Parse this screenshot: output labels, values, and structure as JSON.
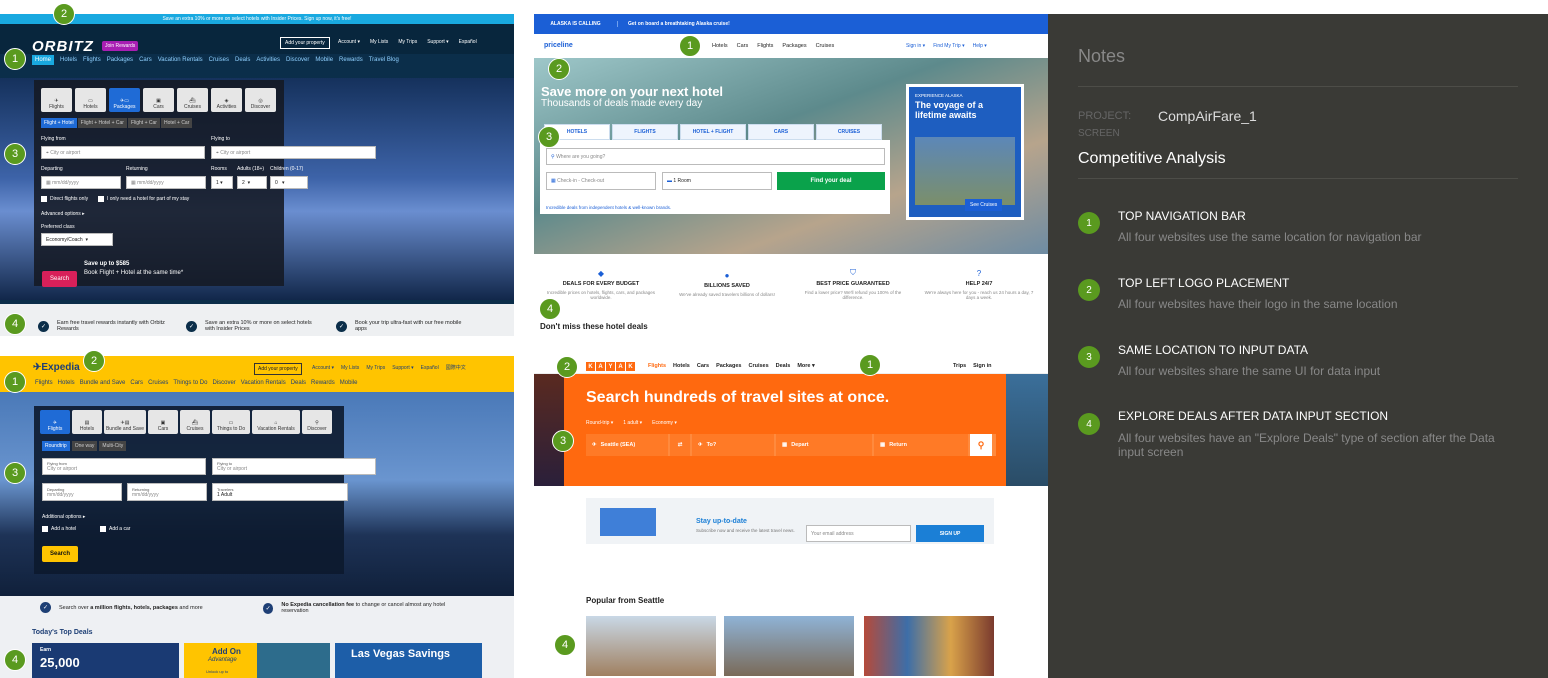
{
  "orbitz": {
    "promo": "Save an extra 10% or more on select hotels with Insider Prices.  Sign up now, it's free!",
    "logo": "ORBITZ",
    "join": "Join Rewards",
    "add_property": "Add your property",
    "account_links": [
      "Account ▾",
      "My Lists",
      "My Trips",
      "Support ▾",
      "Español"
    ],
    "nav": [
      "Home",
      "Hotels",
      "Flights",
      "Packages",
      "Cars",
      "Vacation Rentals",
      "Cruises",
      "Deals",
      "Activities",
      "Discover",
      "Mobile",
      "Rewards",
      "Travel Blog"
    ],
    "tabs": [
      "Flights",
      "Hotels",
      "Packages",
      "Cars",
      "Cruises",
      "Activities",
      "Discover"
    ],
    "subtabs": [
      "Flight + Hotel",
      "Flight + Hotel + Car",
      "Flight + Car",
      "Hotel + Car"
    ],
    "flying_from": "Flying from",
    "flying_to": "Flying to",
    "city_placeholder": "City or airport",
    "departing": "Departing",
    "returning": "Returning",
    "date_placeholder": "mm/dd/yyyy",
    "rooms": "Rooms",
    "adults": "Adults (18+)",
    "children": "Children (0-17)",
    "rooms_val": "1",
    "adults_val": "2",
    "children_val": "0",
    "direct": "Direct flights only",
    "partial": "I only need a hotel for part of my stay",
    "advanced": "Advanced options ▸",
    "pref_class": "Preferred class",
    "class_val": "Economy/Coach",
    "search": "Search",
    "save_title": "Save up to $585",
    "save_sub": "Book Flight + Hotel at the same time*",
    "benefits": [
      "Earn free travel rewards instantly with Orbitz Rewards",
      "Save an extra 10% or more on select hotels with Insider Prices",
      "Book your trip ultra-fast with our free mobile apps"
    ]
  },
  "priceline": {
    "alaska": "ALASKA IS CALLING",
    "alaska_sub": "Get on board a breathtaking Alaska cruise!",
    "logo": "priceline",
    "nav": [
      "Hotels",
      "Cars",
      "Flights",
      "Packages",
      "Cruises"
    ],
    "right": [
      "Sign in ▾",
      "Find My Trip ▾",
      "Help ▾"
    ],
    "h1": "Save more on your next hotel",
    "h2": "Thousands of deals made every day",
    "tabs": [
      "HOTELS",
      "FLIGHTS",
      "HOTEL + FLIGHT",
      "CARS",
      "CRUISES"
    ],
    "where": "Where are you going?",
    "checkin": "Check-in - Check-out",
    "rooms": "1 Room",
    "find": "Find your deal",
    "incredible": "Incredible deals from independent hotels & well-known brands.",
    "promo_kicker": "EXPERIENCE ALASKA",
    "promo_title": "The voyage of a lifetime awaits",
    "promo_cta": "See Cruises",
    "benefits": [
      {
        "title": "DEALS FOR EVERY BUDGET",
        "text": "Incredible prices on hotels, flights, cars, and packages worldwide."
      },
      {
        "title": "BILLIONS SAVED",
        "text": "We've already saved travelers billions of dollars!"
      },
      {
        "title": "BEST PRICE GUARANTEED",
        "text": "Find a lower price? We'll refund you 100% of the difference."
      },
      {
        "title": "HELP 24/7",
        "text": "We're always here for you - reach us 24 hours a day, 7 days a week."
      }
    ],
    "dont_miss": "Don't miss these hotel deals"
  },
  "expedia": {
    "logo": "Expedia",
    "add_property": "Add your property",
    "account_links": [
      "Account ▾",
      "My Lists",
      "My Trips",
      "Support ▾",
      "Español",
      "國際中文"
    ],
    "nav": [
      "Flights",
      "Hotels",
      "Bundle and Save",
      "Cars",
      "Cruises",
      "Things to Do",
      "Discover",
      "Vacation Rentals",
      "Deals",
      "Rewards",
      "Mobile"
    ],
    "tabs": [
      "Flights",
      "Hotels",
      "Bundle and Save",
      "Cars",
      "Cruises",
      "Things to Do",
      "Vacation Rentals",
      "Discover"
    ],
    "subtabs": [
      "Roundtrip",
      "One way",
      "Multi-City"
    ],
    "flying_from": "Flying from",
    "flying_to": "Flying to",
    "city_placeholder": "City or airport",
    "departing": "Departing",
    "returning": "Returning",
    "date_placeholder": "mm/dd/yyyy",
    "travelers": "Travelers",
    "travelers_val": "1 Adult",
    "additional": "Additional options ▸",
    "add_hotel": "Add a hotel",
    "add_car": "Add a car",
    "search": "Search",
    "benefit1_a": "Search over ",
    "benefit1_b": "a million flights, hotels, packages",
    "benefit1_c": " and more",
    "benefit2_a": "No Expedia cancellation fee",
    "benefit2_b": " to change or cancel almost any hotel reservation",
    "top_deals": "Today's Top Deals",
    "deal1_small": "Earn",
    "deal1_big": "25,000",
    "deal2_a": "Add On",
    "deal2_b": "Advantage",
    "deal2_c": "Unlock up to",
    "deal3": "Las Vegas Savings"
  },
  "kayak": {
    "logo_letters": [
      "K",
      "A",
      "Y",
      "A",
      "K"
    ],
    "nav": [
      "Flights",
      "Hotels",
      "Cars",
      "Packages",
      "Cruises",
      "Deals",
      "More ▾"
    ],
    "right": [
      "Trips",
      "Sign in"
    ],
    "h1": "Search hundreds of travel sites at once.",
    "opts": [
      "Round-trip ▾",
      "1 adult ▾",
      "Economy ▾"
    ],
    "from": "Seattle (SEA)",
    "to": "To?",
    "depart": "Depart",
    "return": "Return",
    "stay_title": "Stay up-to-date",
    "stay_sub": "Subscribe now and receive the latest travel news.",
    "email": "Your email address",
    "signup": "SIGN UP",
    "popular": "Popular from Seattle"
  },
  "badges": {
    "o2": "2",
    "o1": "1",
    "o3": "3",
    "o4": "4",
    "p1": "1",
    "p2": "2",
    "p3": "3",
    "p4": "4",
    "e2": "2",
    "e1": "1",
    "e3": "3",
    "e4": "4",
    "k2": "2",
    "k1": "1",
    "k3": "3",
    "k4": "4"
  },
  "notes": {
    "heading": "Notes",
    "project_label": "PROJECT:",
    "project": "CompAirFare_1",
    "screen_label": "SCREEN",
    "screen": "Competitive Analysis",
    "items": [
      {
        "num": "1",
        "title": "TOP NAVIGATION BAR",
        "desc": "All four websites use the same location for navigation bar"
      },
      {
        "num": "2",
        "title": "TOP LEFT LOGO PLACEMENT",
        "desc": "All four websites have their logo in the same location"
      },
      {
        "num": "3",
        "title": "SAME LOCATION TO INPUT DATA",
        "desc": "All four websites share the same UI for data input"
      },
      {
        "num": "4",
        "title": "EXPLORE DEALS AFTER DATA INPUT SECTION",
        "desc": "All four websites have an \"Explore Deals\" type of section after the Data input screen"
      }
    ]
  }
}
